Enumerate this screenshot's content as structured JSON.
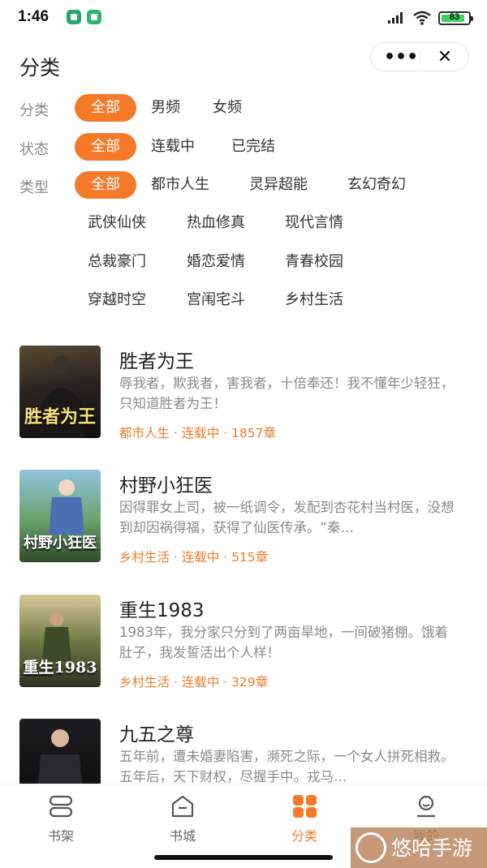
{
  "status_bar": {
    "time": "1:46",
    "battery": "83"
  },
  "header": {
    "title": "分类"
  },
  "filters": [
    {
      "label": "分类",
      "options": [
        "全部",
        "男频",
        "女频"
      ]
    },
    {
      "label": "状态",
      "options": [
        "全部",
        "连载中",
        "已完结"
      ]
    },
    {
      "label": "类型",
      "options": [
        "全部",
        "都市人生",
        "灵异超能",
        "玄幻奇幻",
        "武侠仙侠",
        "热血修真",
        "现代言情",
        "总裁豪门",
        "婚恋爱情",
        "青春校园",
        "穿越时空",
        "宫闱宅斗",
        "乡村生活"
      ]
    }
  ],
  "books": [
    {
      "title": "胜者为王",
      "cover_text": "胜者为王",
      "description": "辱我者，欺我者，害我者，十倍奉还！我不懂年少轻狂，只知道胜者为王！",
      "meta": "都市人生 · 连载中 · 1857章"
    },
    {
      "title": "村野小狂医",
      "cover_text": "村野小狂医",
      "description": "因得罪女上司，被一纸调令，发配到杏花村当村医，没想到却因祸得福，获得了仙医传承。“秦…",
      "meta": "乡村生活 · 连载中 · 515章"
    },
    {
      "title": "重生1983",
      "cover_text": "重生1983",
      "description": "1983年，我分家只分到了两亩旱地，一间破猪棚。饿着肚子，我发誓活出个人样！",
      "meta": "乡村生活 · 连载中 · 329章"
    },
    {
      "title": "九五之尊",
      "cover_text": "",
      "description": "五年前，遭未婚妻陷害，濒死之际，一个女人拼死相救。五年后，天下财权，尽握手中。戎马…",
      "meta": ""
    }
  ],
  "nav": [
    {
      "label": "书架",
      "icon": "bookshelf-icon"
    },
    {
      "label": "书城",
      "icon": "bookstore-icon"
    },
    {
      "label": "分类",
      "icon": "category-icon"
    },
    {
      "label": "我的",
      "icon": "profile-icon"
    }
  ],
  "watermark": {
    "text": "悠哈手游"
  },
  "colors": {
    "accent": "#f47a2a",
    "meta": "#e87c2a"
  }
}
